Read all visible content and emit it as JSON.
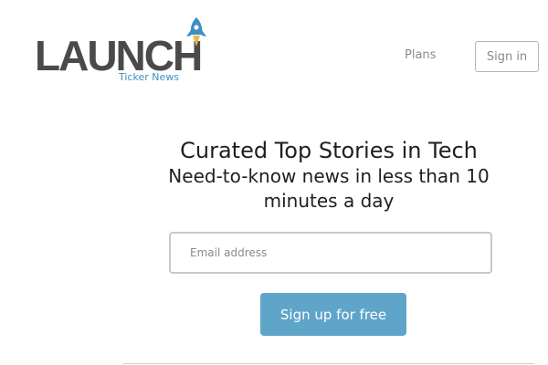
{
  "header": {
    "logo": {
      "wordmark": "LAUNCH",
      "subtitle": "Ticker News",
      "icon": "rocket-icon"
    },
    "nav": {
      "plans_label": "Plans",
      "signin_label": "Sign in"
    }
  },
  "hero": {
    "title": "Curated Top Stories in Tech",
    "subtitle": "Need-to-know news in less than 10 minutes a day"
  },
  "signup_form": {
    "email_placeholder": "Email address",
    "email_value": "",
    "submit_label": "Sign up for free"
  },
  "colors": {
    "accent": "#5fa5c9",
    "logo_text": "#4a4a4a",
    "logo_sub": "#3a8fc0"
  }
}
